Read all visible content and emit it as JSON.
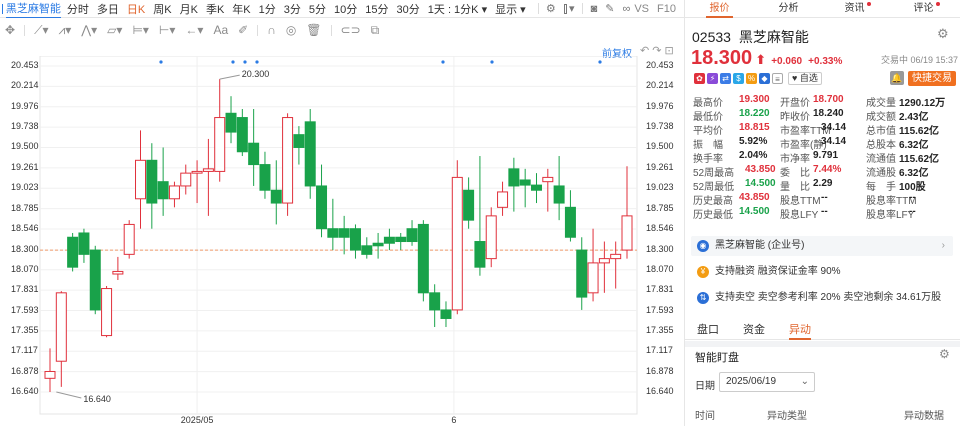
{
  "toolbar": {
    "stock_name": "黑芝麻智能",
    "periods": [
      "分时",
      "多日",
      "日K",
      "周K",
      "月K",
      "季K",
      "年K",
      "1分",
      "3分",
      "5分",
      "10分",
      "15分",
      "30分"
    ],
    "active_period": "日K",
    "range_select": "1天 : 1分K",
    "display_select": "显示",
    "vs_label": "VS",
    "f10_label": "F10",
    "adj_label": "前复权"
  },
  "chart": {
    "y_ticks": [
      "20.453",
      "20.214",
      "19.976",
      "19.738",
      "19.500",
      "19.261",
      "19.023",
      "18.785",
      "18.546",
      "18.300",
      "18.070",
      "17.831",
      "17.593",
      "17.355",
      "17.117",
      "16.878",
      "16.640"
    ],
    "x_labels": [
      "2025/05",
      "6"
    ],
    "high_label": "20.300",
    "low_label": "16.640",
    "price_line": 18.3,
    "ymin": 16.64,
    "ymax": 20.453,
    "up_color": "#e0303b",
    "down_color": "#19a24a"
  },
  "chart_data": {
    "type": "candlestick",
    "candles": [
      [
        16.8,
        16.88,
        16.64,
        17.15
      ],
      [
        17.0,
        17.8,
        16.7,
        17.82
      ],
      [
        18.45,
        18.1,
        18.05,
        18.5
      ],
      [
        18.5,
        18.25,
        18.15,
        18.55
      ],
      [
        18.3,
        17.6,
        17.55,
        18.35
      ],
      [
        17.3,
        17.85,
        17.28,
        17.88
      ],
      [
        18.02,
        18.05,
        17.95,
        18.22
      ],
      [
        18.25,
        18.6,
        18.2,
        18.65
      ],
      [
        18.9,
        19.35,
        18.55,
        19.7
      ],
      [
        19.35,
        18.85,
        18.55,
        19.55
      ],
      [
        19.1,
        18.9,
        18.7,
        19.5
      ],
      [
        18.9,
        19.05,
        18.8,
        19.1
      ],
      [
        19.05,
        19.2,
        18.95,
        19.3
      ],
      [
        19.2,
        19.22,
        18.85,
        19.35
      ],
      [
        19.22,
        19.25,
        18.7,
        19.6
      ],
      [
        19.22,
        19.85,
        19.1,
        20.3
      ],
      [
        19.9,
        19.68,
        19.55,
        20.1
      ],
      [
        19.85,
        19.45,
        19.4,
        19.95
      ],
      [
        19.55,
        19.3,
        19.05,
        19.95
      ],
      [
        19.3,
        19.0,
        18.9,
        19.45
      ],
      [
        19.0,
        18.85,
        18.6,
        19.35
      ],
      [
        18.85,
        19.85,
        18.7,
        19.9
      ],
      [
        19.65,
        19.5,
        19.3,
        19.75
      ],
      [
        19.8,
        19.05,
        18.9,
        19.95
      ],
      [
        19.05,
        18.55,
        18.45,
        19.3
      ],
      [
        18.55,
        18.45,
        18.3,
        18.9
      ],
      [
        18.55,
        18.45,
        18.25,
        18.7
      ],
      [
        18.55,
        18.3,
        18.2,
        18.6
      ],
      [
        18.35,
        18.25,
        18.2,
        18.45
      ],
      [
        18.38,
        18.35,
        18.2,
        18.5
      ],
      [
        18.45,
        18.38,
        18.3,
        18.55
      ],
      [
        18.45,
        18.4,
        18.3,
        18.5
      ],
      [
        18.55,
        18.4,
        18.35,
        18.65
      ],
      [
        18.6,
        17.8,
        17.7,
        18.65
      ],
      [
        17.8,
        17.6,
        17.4,
        17.9
      ],
      [
        17.6,
        17.5,
        17.4,
        17.7
      ],
      [
        17.6,
        19.15,
        17.55,
        19.35
      ],
      [
        19.0,
        18.65,
        18.55,
        19.15
      ],
      [
        18.4,
        18.1,
        18.0,
        19.4
      ],
      [
        18.2,
        18.7,
        18.1,
        18.8
      ],
      [
        18.8,
        18.98,
        18.7,
        19.1
      ],
      [
        19.25,
        19.05,
        18.75,
        19.38
      ],
      [
        19.12,
        19.06,
        18.8,
        19.25
      ],
      [
        19.06,
        19.0,
        18.85,
        19.2
      ],
      [
        19.1,
        19.15,
        18.75,
        19.25
      ],
      [
        19.05,
        18.85,
        18.65,
        19.4
      ],
      [
        18.8,
        18.45,
        18.4,
        19.0
      ],
      [
        18.3,
        17.75,
        17.6,
        18.45
      ],
      [
        17.8,
        18.15,
        17.7,
        18.55
      ],
      [
        18.15,
        18.2,
        17.8,
        18.4
      ],
      [
        18.2,
        18.25,
        17.85,
        18.4
      ],
      [
        18.3,
        18.7,
        18.2,
        19.28
      ]
    ]
  },
  "right": {
    "tabs": [
      "报价",
      "分析",
      "资讯",
      "评论"
    ],
    "code": "02533",
    "name": "黑芝麻智能",
    "price": "18.300",
    "arrow": "⬆",
    "change": "+0.060",
    "pct": "+0.33%",
    "trade_status": "交易中 06/19 15:37",
    "watch_label": "自选",
    "trade_btn": "快捷交易",
    "stats": [
      [
        [
          "最高价",
          "19.300",
          "red"
        ],
        [
          "开盘价",
          "18.700",
          "red"
        ],
        [
          "成交量",
          "1290.12万",
          "blk"
        ]
      ],
      [
        [
          "最低价",
          "18.220",
          "grn"
        ],
        [
          "昨收价",
          "18.240",
          "blk"
        ],
        [
          "成交额",
          "2.43亿",
          "blk"
        ]
      ],
      [
        [
          "平均价",
          "18.815",
          "red"
        ],
        [
          "市盈率TTM",
          "34.14",
          "blk"
        ],
        [
          "总市值",
          "115.62亿",
          "blk"
        ]
      ],
      [
        [
          "振　幅",
          "5.92%",
          "blk"
        ],
        [
          "市盈率(静)",
          "34.14",
          "blk"
        ],
        [
          "总股本",
          "6.32亿",
          "blk"
        ]
      ],
      [
        [
          "换手率",
          "2.04%",
          "blk"
        ],
        [
          "市净率",
          "9.791",
          "blk"
        ],
        [
          "流通值",
          "115.62亿",
          "blk"
        ]
      ],
      [
        [
          "52周最高",
          "43.850",
          "red"
        ],
        [
          "委　比",
          "7.44%",
          "red"
        ],
        [
          "流通股",
          "6.32亿",
          "blk"
        ]
      ],
      [
        [
          "52周最低",
          "14.500",
          "grn"
        ],
        [
          "量　比",
          "2.29",
          "blk"
        ],
        [
          "每　手",
          "100股",
          "blk"
        ]
      ],
      [
        [
          "历史最高",
          "43.850",
          "red"
        ],
        [
          "股息TTM",
          "--",
          "blk"
        ],
        [
          "股息率TTM",
          "--",
          "blk"
        ]
      ],
      [
        [
          "历史最低",
          "14.500",
          "grn"
        ],
        [
          "股息LFY",
          "--",
          "blk"
        ],
        [
          "股息率LFY",
          "--",
          "blk"
        ]
      ]
    ],
    "company_link": "黑芝麻智能 (企业号)",
    "margin_info": "支持融资 融资保证金率 90%",
    "short_info": "支持卖空 卖空参考利率 20% 卖空池剩余 34.61万股",
    "bottom_tabs": [
      "盘口",
      "资金",
      "异动"
    ],
    "section_title": "智能盯盘",
    "date_label": "日期",
    "date_value": "2025/06/19",
    "col_time": "时间",
    "col_type": "异动类型",
    "col_data": "异动数据"
  }
}
